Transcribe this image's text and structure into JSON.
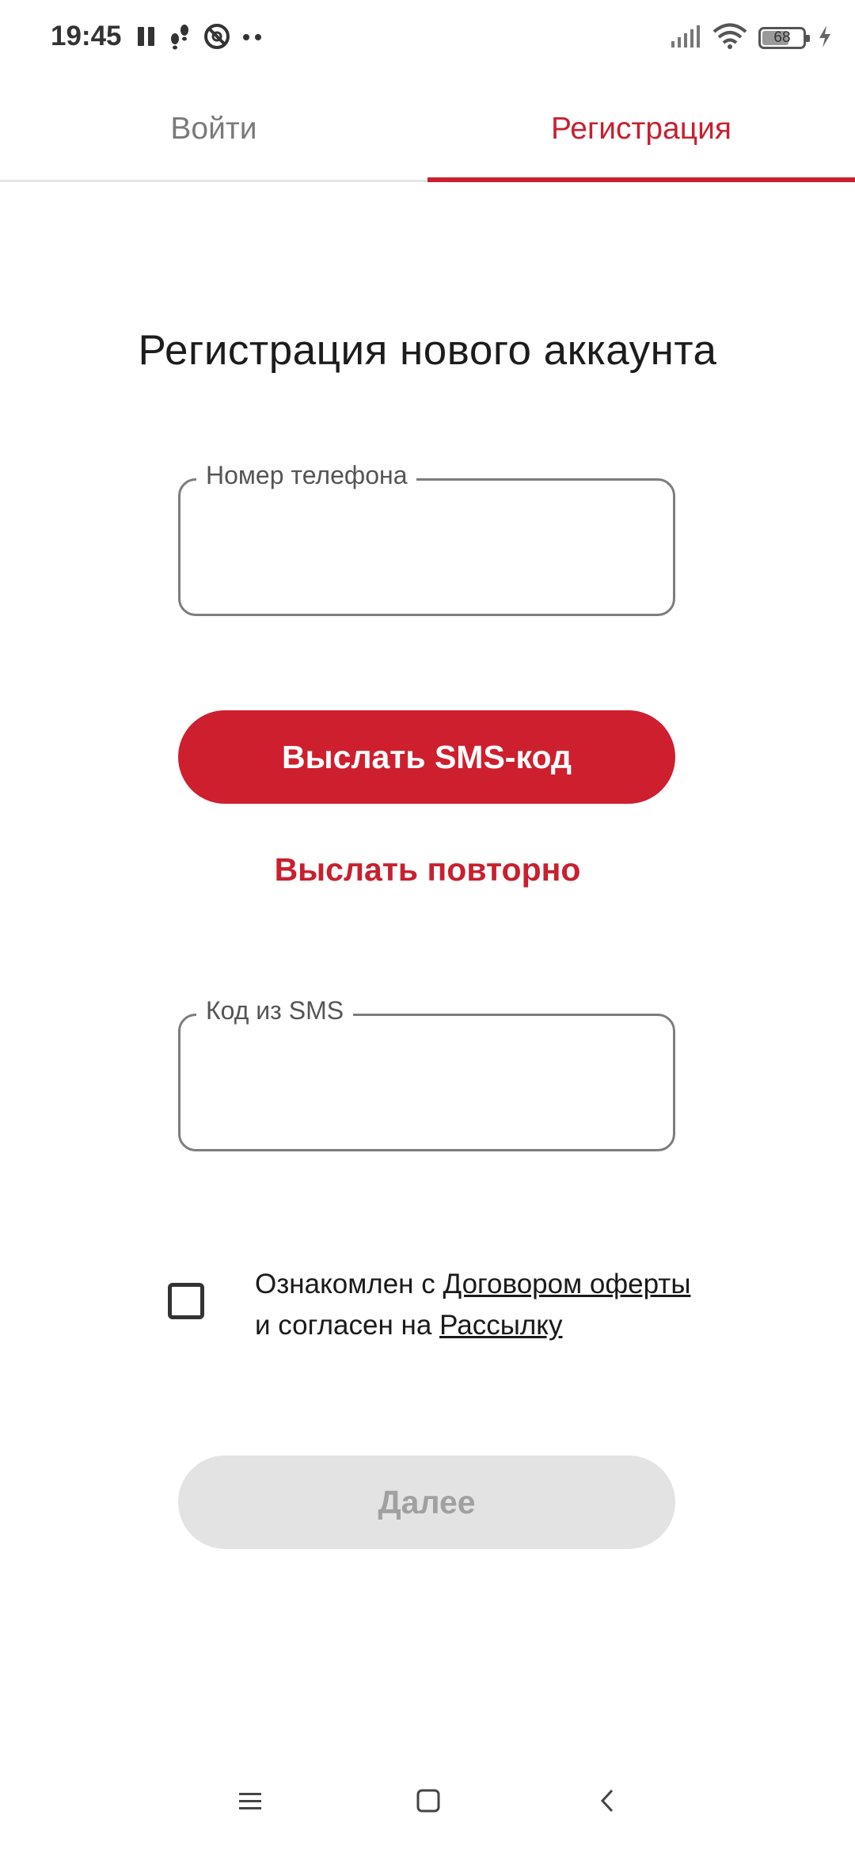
{
  "status_bar": {
    "time": "19:45",
    "battery": "68",
    "icons": [
      "pause-icon",
      "footsteps-icon",
      "at-icon",
      "more-dots-icon",
      "signal-icon",
      "wifi-icon",
      "battery-icon",
      "charging-icon"
    ]
  },
  "tabs": [
    {
      "label": "Войти",
      "active": false
    },
    {
      "label": "Регистрация",
      "active": true
    }
  ],
  "page_title": "Регистрация нового аккаунта",
  "phone_field": {
    "label": "Номер телефона",
    "value": ""
  },
  "send_sms_button": "Выслать SMS-код",
  "resend_link": "Выслать повторно",
  "sms_code_field": {
    "label": "Код из SMS",
    "value": ""
  },
  "consent": {
    "checked": false,
    "text_1": "Ознакомлен с ",
    "link_offer": "Договором оферты",
    "text_2": "и согласен на ",
    "link_newsletter": "Рассылку"
  },
  "next_button": "Далее",
  "colors": {
    "accent": "#c8202f",
    "button_red": "#ce1f2f",
    "disabled_bg": "#e3e3e3",
    "disabled_text": "#a0a0a0"
  },
  "nav_bar": {
    "icons": [
      "menu-icon",
      "home-icon",
      "back-icon"
    ]
  }
}
